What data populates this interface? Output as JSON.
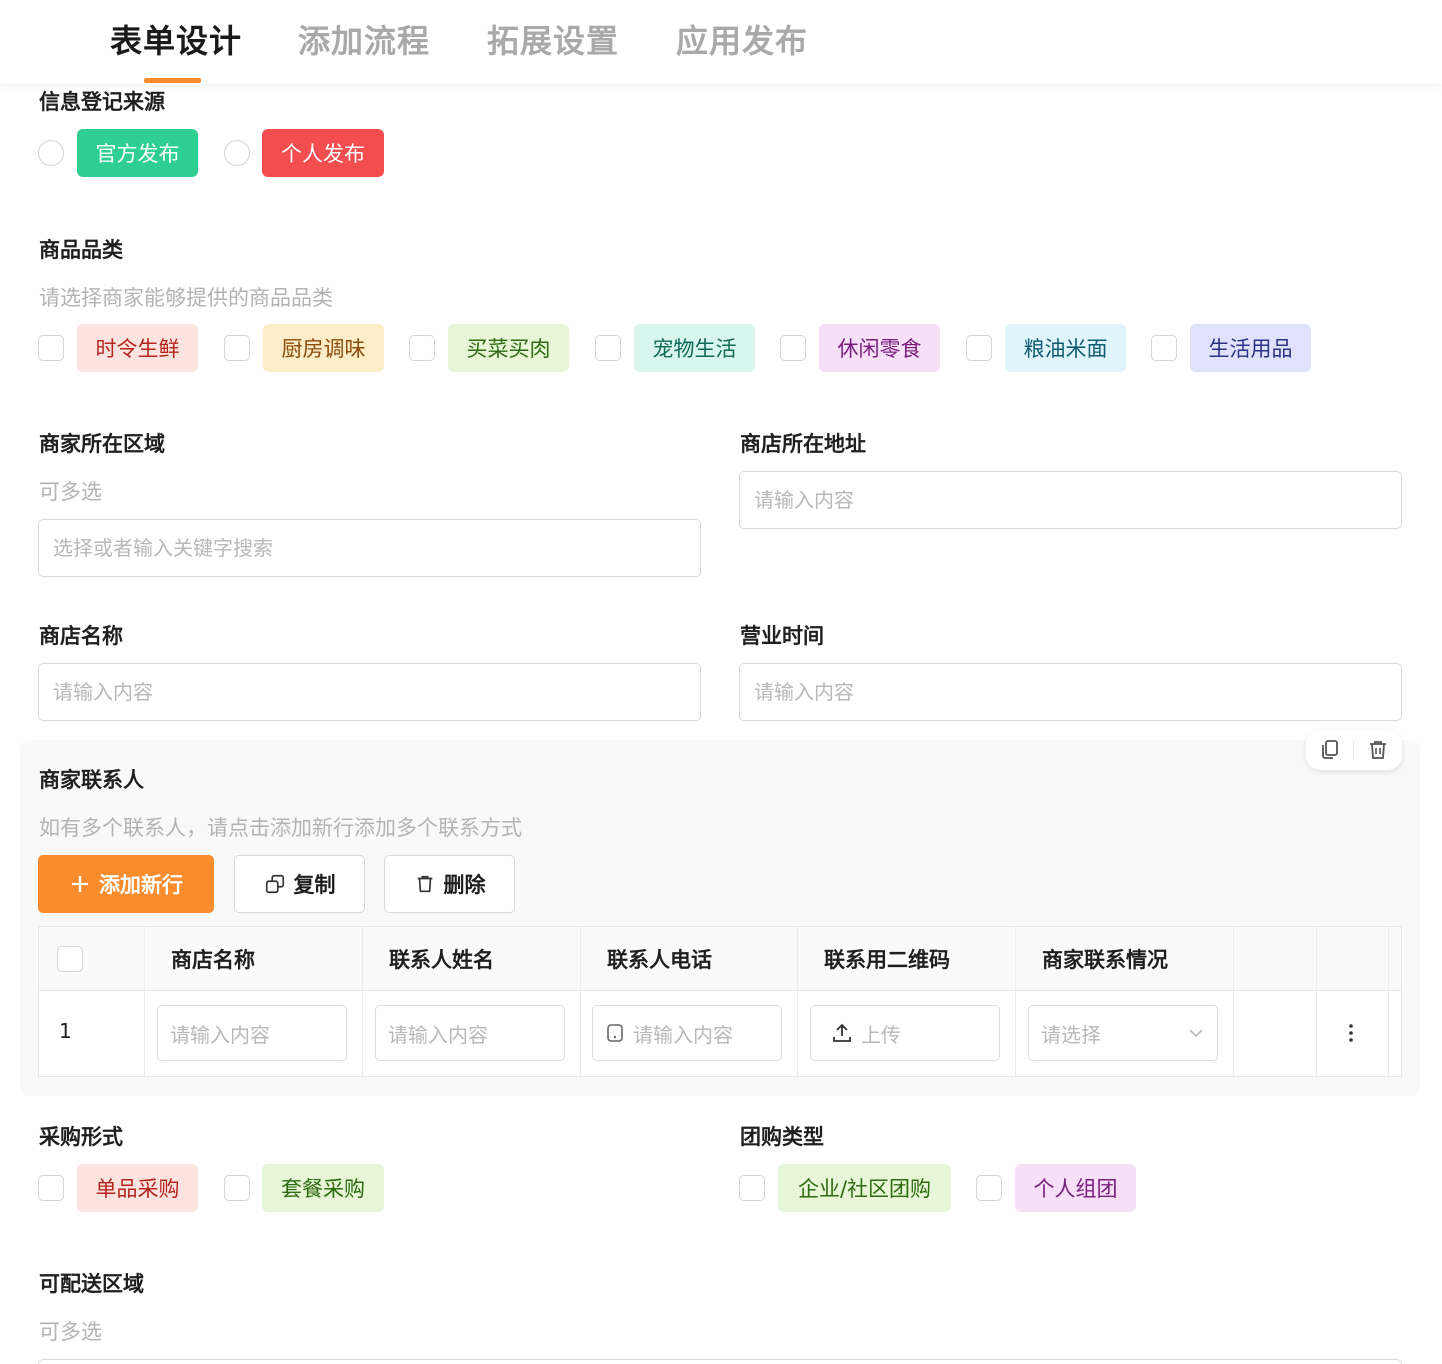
{
  "tabs": [
    {
      "label": "表单设计",
      "active": true
    },
    {
      "label": "添加流程",
      "active": false
    },
    {
      "label": "拓展设置",
      "active": false
    },
    {
      "label": "应用发布",
      "active": false
    }
  ],
  "source": {
    "label": "信息登记来源",
    "options": [
      {
        "text": "官方发布",
        "bg": "#2ecf91",
        "fg": "#ffffff"
      },
      {
        "text": "个人发布",
        "bg": "#f34d4f",
        "fg": "#ffffff"
      }
    ]
  },
  "category": {
    "label": "商品品类",
    "hint": "请选择商家能够提供的商品品类",
    "options": [
      {
        "text": "时令生鲜",
        "bg": "#fde3e0",
        "fg": "#b3261e"
      },
      {
        "text": "厨房调味",
        "bg": "#fdecc8",
        "fg": "#8a4b08"
      },
      {
        "text": "买菜买肉",
        "bg": "#e6f6d6",
        "fg": "#2f6b12"
      },
      {
        "text": "宠物生活",
        "bg": "#d8f6ee",
        "fg": "#0f6a57"
      },
      {
        "text": "休闲零食",
        "bg": "#f6dff7",
        "fg": "#7a1f80"
      },
      {
        "text": "粮油米面",
        "bg": "#dff5fb",
        "fg": "#0f5c72"
      },
      {
        "text": "生活用品",
        "bg": "#e0e2fb",
        "fg": "#2a3284"
      }
    ]
  },
  "region": {
    "label": "商家所在区域",
    "hint": "可多选",
    "placeholder": "选择或者输入关键字搜索"
  },
  "address": {
    "label": "商店所在地址",
    "placeholder": "请输入内容"
  },
  "store_name": {
    "label": "商店名称",
    "placeholder": "请输入内容"
  },
  "hours": {
    "label": "营业时间",
    "placeholder": "请输入内容"
  },
  "contacts": {
    "label": "商家联系人",
    "hint": "如有多个联系人，请点击添加新行添加多个联系方式",
    "add_label": "添加新行",
    "copy_label": "复制",
    "delete_label": "删除",
    "columns": [
      "商店名称",
      "联系人姓名",
      "联系人电话",
      "联系用二维码",
      "商家联系情况"
    ],
    "rows": [
      {
        "index": "1",
        "store": "请输入内容",
        "name": "请输入内容",
        "phone": "请输入内容",
        "upload": "上传",
        "status": "请选择"
      }
    ]
  },
  "purchase": {
    "label": "采购形式",
    "options": [
      {
        "text": "单品采购",
        "bg": "#fde3e0",
        "fg": "#b3261e"
      },
      {
        "text": "套餐采购",
        "bg": "#e6f6d6",
        "fg": "#2f6b12"
      }
    ]
  },
  "group_type": {
    "label": "团购类型",
    "options": [
      {
        "text": "企业/社区团购",
        "bg": "#e6f6d6",
        "fg": "#2f6b12"
      },
      {
        "text": "个人组团",
        "bg": "#f6dff7",
        "fg": "#7a1f80"
      }
    ]
  },
  "delivery": {
    "label": "可配送区域",
    "hint": "可多选"
  }
}
